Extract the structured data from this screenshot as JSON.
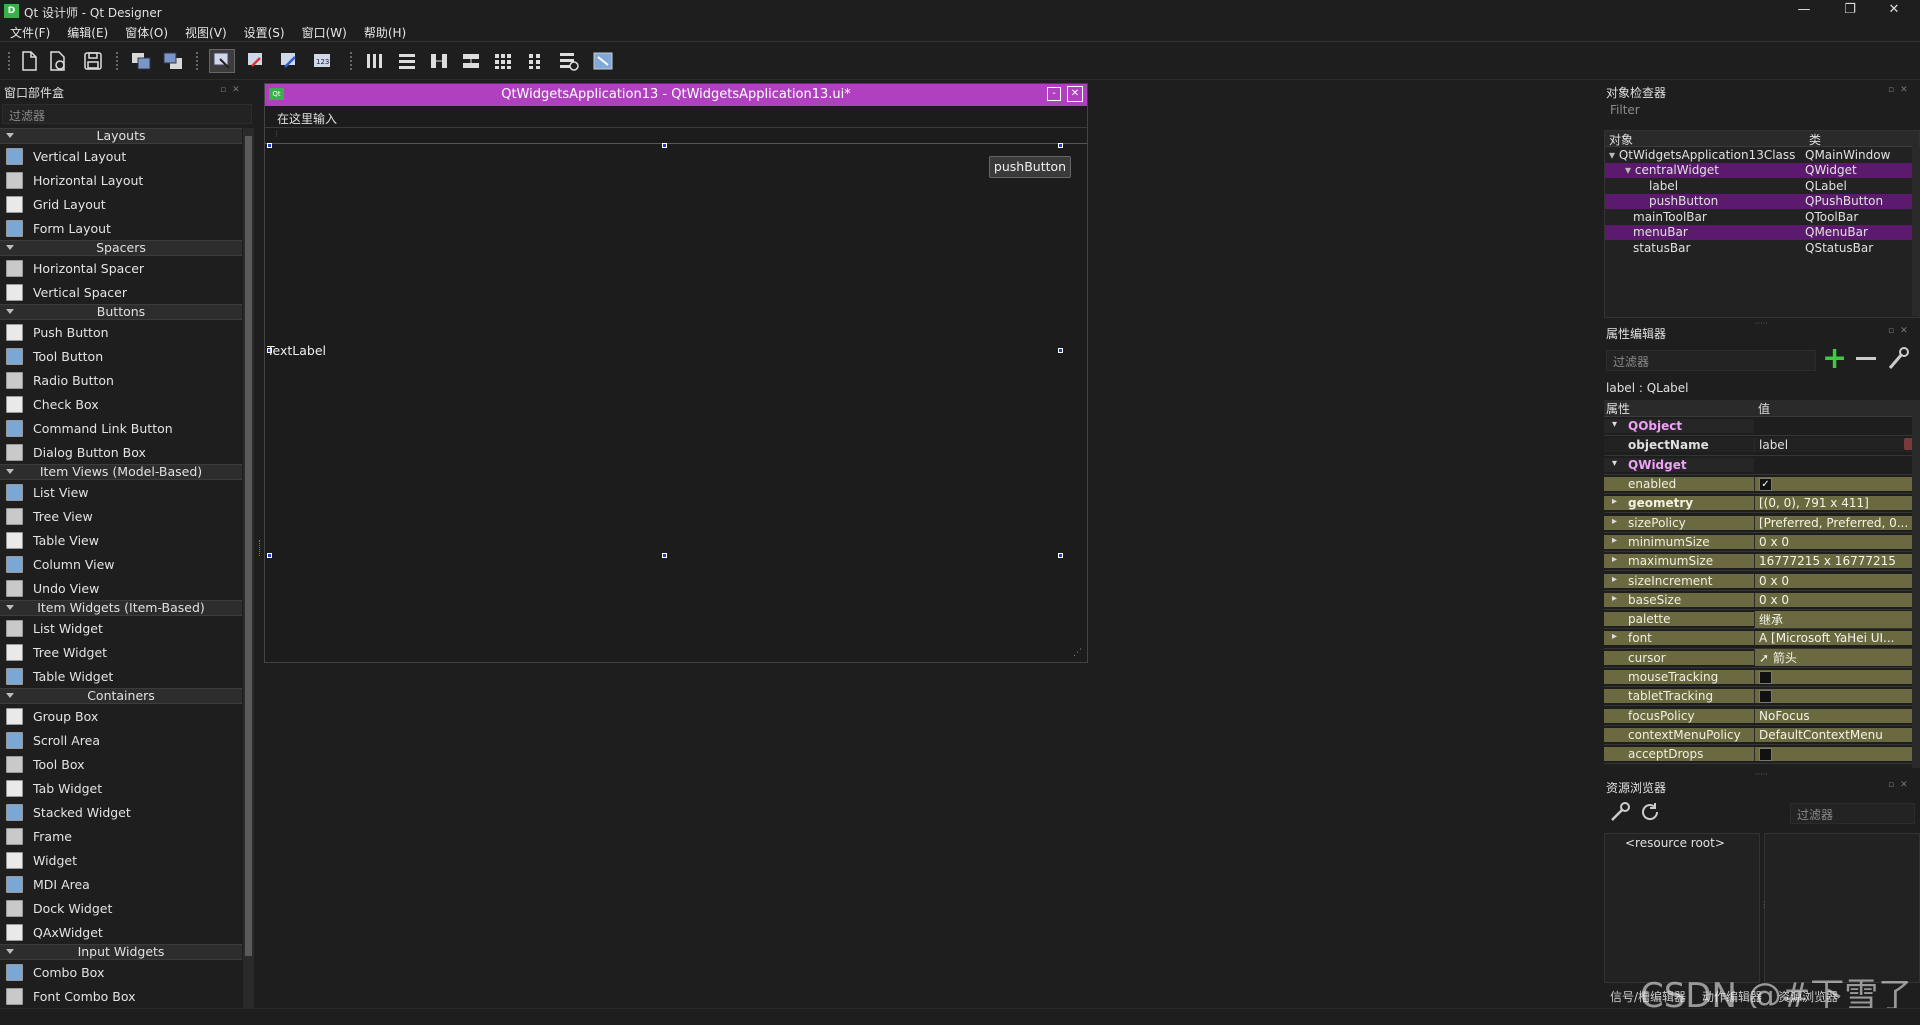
{
  "window": {
    "title": "Qt 设计师 - Qt Designer",
    "icon": "qt-designer-logo"
  },
  "menu": [
    "文件(F)",
    "编辑(E)",
    "窗体(O)",
    "视图(V)",
    "设置(S)",
    "窗口(W)",
    "帮助(H)"
  ],
  "widget_box": {
    "title": "窗口部件盒",
    "filter_placeholder": "过滤器",
    "categories": [
      {
        "name": "Layouts",
        "items": [
          "Vertical Layout",
          "Horizontal Layout",
          "Grid Layout",
          "Form Layout"
        ]
      },
      {
        "name": "Spacers",
        "items": [
          "Horizontal Spacer",
          "Vertical Spacer"
        ]
      },
      {
        "name": "Buttons",
        "items": [
          "Push Button",
          "Tool Button",
          "Radio Button",
          "Check Box",
          "Command Link Button",
          "Dialog Button Box"
        ]
      },
      {
        "name": "Item Views (Model-Based)",
        "items": [
          "List View",
          "Tree View",
          "Table View",
          "Column View",
          "Undo View"
        ]
      },
      {
        "name": "Item Widgets (Item-Based)",
        "items": [
          "List Widget",
          "Tree Widget",
          "Table Widget"
        ]
      },
      {
        "name": "Containers",
        "items": [
          "Group Box",
          "Scroll Area",
          "Tool Box",
          "Tab Widget",
          "Stacked Widget",
          "Frame",
          "Widget",
          "MDI Area",
          "Dock Widget",
          "QAxWidget"
        ]
      },
      {
        "name": "Input Widgets",
        "items": [
          "Combo Box",
          "Font Combo Box"
        ]
      }
    ]
  },
  "form": {
    "title": "QtWidgetsApplication13 - QtWidgetsApplication13.ui*",
    "menu_placeholder": "在这里输入",
    "push_button": "pushButton",
    "label": "TextLabel",
    "min_btn": "-",
    "close_btn": "✕"
  },
  "object_inspector": {
    "title": "对象检查器",
    "filter_placeholder": "Filter",
    "col_object": "对象",
    "col_class": "类",
    "rows": [
      {
        "name": "QtWidgetsApplication13Class",
        "cls": "QMainWindow"
      },
      {
        "name": "centralWidget",
        "cls": "QWidget"
      },
      {
        "name": "label",
        "cls": "QLabel"
      },
      {
        "name": "pushButton",
        "cls": "QPushButton"
      },
      {
        "name": "mainToolBar",
        "cls": "QToolBar"
      },
      {
        "name": "menuBar",
        "cls": "QMenuBar"
      },
      {
        "name": "statusBar",
        "cls": "QStatusBar"
      }
    ]
  },
  "property_editor": {
    "title": "属性编辑器",
    "filter_placeholder": "过滤器",
    "selected": "label : QLabel",
    "col_prop": "属性",
    "col_value": "值",
    "qobject": "QObject",
    "object_name_key": "objectName",
    "object_name_val": "label",
    "qwidget": "QWidget",
    "rows": [
      {
        "name": "enabled",
        "value": "✓",
        "kind": "check"
      },
      {
        "name": "geometry",
        "value": "[(0, 0), 791 x 411]",
        "kind": "exp"
      },
      {
        "name": "sizePolicy",
        "value": "[Preferred, Preferred, 0...",
        "kind": "exp"
      },
      {
        "name": "minimumSize",
        "value": "0 x 0",
        "kind": "exp"
      },
      {
        "name": "maximumSize",
        "value": "16777215 x 16777215",
        "kind": "exp"
      },
      {
        "name": "sizeIncrement",
        "value": "0 x 0",
        "kind": "exp"
      },
      {
        "name": "baseSize",
        "value": "0 x 0",
        "kind": "exp"
      },
      {
        "name": "palette",
        "value": "继承",
        "kind": "plain"
      },
      {
        "name": "font",
        "value": "[Microsoft YaHei UI...",
        "kind": "exp"
      },
      {
        "name": "cursor",
        "value": "箭头",
        "kind": "plain"
      },
      {
        "name": "mouseTracking",
        "value": "",
        "kind": "check"
      },
      {
        "name": "tabletTracking",
        "value": "",
        "kind": "check"
      },
      {
        "name": "focusPolicy",
        "value": "NoFocus",
        "kind": "plain"
      },
      {
        "name": "contextMenuPolicy",
        "value": "DefaultContextMenu",
        "kind": "plain"
      },
      {
        "name": "acceptDrops",
        "value": "",
        "kind": "check"
      }
    ]
  },
  "resource_browser": {
    "title": "资源浏览器",
    "filter_placeholder": "过滤器",
    "root": "<resource root>"
  },
  "bottom_tabs": [
    "信号/槽编辑器",
    "动作编辑器",
    "资源浏览器"
  ],
  "watermark": "CSDN @#下雪了"
}
